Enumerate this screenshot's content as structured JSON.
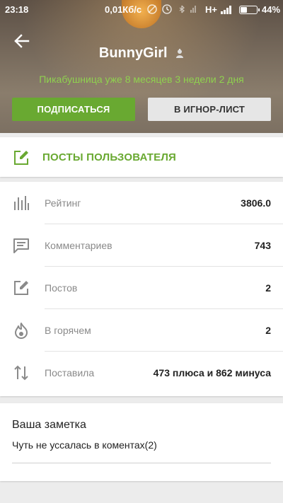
{
  "status_bar": {
    "time": "23:18",
    "speed": "0,01Кб/с",
    "network": "H+",
    "battery": "44%",
    "battery_level": 0.44
  },
  "profile": {
    "username": "BunnyGirl",
    "tagline": "Пикабушница уже 8 месяцев 3 недели 2 дня",
    "subscribe_label": "ПОДПИСАТЬСЯ",
    "ignore_label": "В ИГНОР-ЛИСТ"
  },
  "posts_link": {
    "label": "ПОСТЫ ПОЛЬЗОВАТЕЛЯ",
    "icon": "edit-icon"
  },
  "stats": [
    {
      "icon": "rating-bars-icon",
      "label": "Рейтинг",
      "value": "3806.0"
    },
    {
      "icon": "comment-icon",
      "label": "Комментариев",
      "value": "743"
    },
    {
      "icon": "edit-icon",
      "label": "Постов",
      "value": "2"
    },
    {
      "icon": "flame-icon",
      "label": "В горячем",
      "value": "2"
    },
    {
      "icon": "up-down-arrows-icon",
      "label": "Поставила",
      "value": "473 плюса и 862 минуса"
    }
  ],
  "note": {
    "title": "Ваша заметка",
    "text": "Чуть не уссалась в коментах(2)"
  },
  "colors": {
    "accent_green": "#69a931",
    "tagline_green": "#8fd14f",
    "ignore_button": "#e6e6e6",
    "label_gray": "#8a8a8a"
  }
}
